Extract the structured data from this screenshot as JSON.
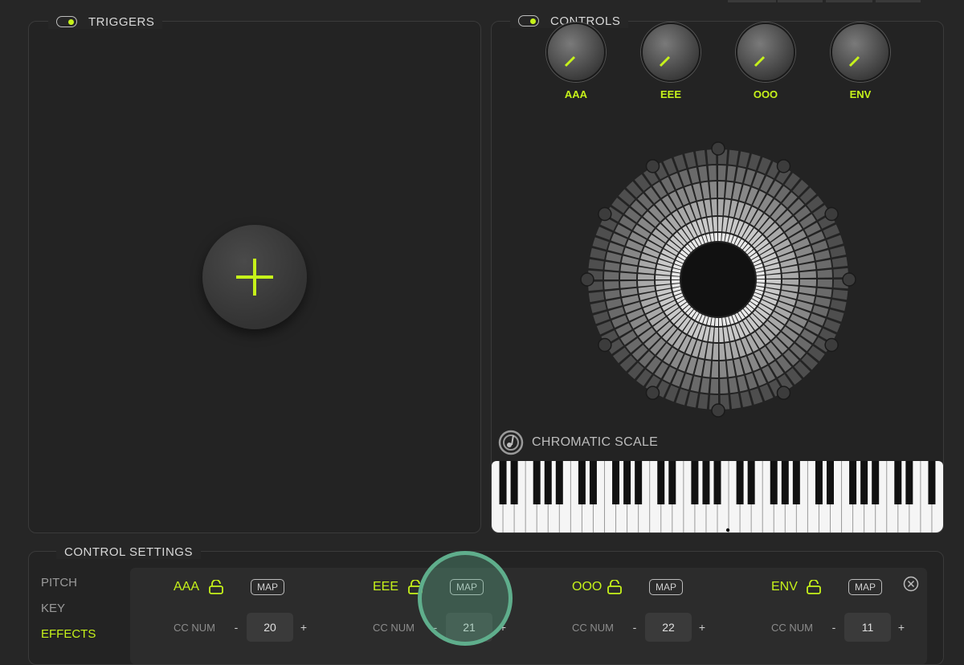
{
  "triggers": {
    "title": "TRIGGERS"
  },
  "controls": {
    "title": "CONTROLS",
    "knobs": [
      {
        "label": "AAA"
      },
      {
        "label": "EEE"
      },
      {
        "label": "OOO"
      },
      {
        "label": "ENV"
      }
    ],
    "scale_label": "CHROMATIC SCALE"
  },
  "settings": {
    "title": "CONTROL SETTINGS",
    "tabs": [
      "PITCH",
      "KEY",
      "EFFECTS"
    ],
    "active_tab": "EFFECTS",
    "cc_label": "CC NUM",
    "map_label": "MAP",
    "minus": "-",
    "plus": "+",
    "controls": [
      {
        "name": "AAA",
        "cc": "20"
      },
      {
        "name": "EEE",
        "cc": "21"
      },
      {
        "name": "OOO",
        "cc": "22"
      },
      {
        "name": "ENV",
        "cc": "11"
      }
    ]
  },
  "colors": {
    "accent": "#c6f21a",
    "highlight": "#5fae8c"
  }
}
